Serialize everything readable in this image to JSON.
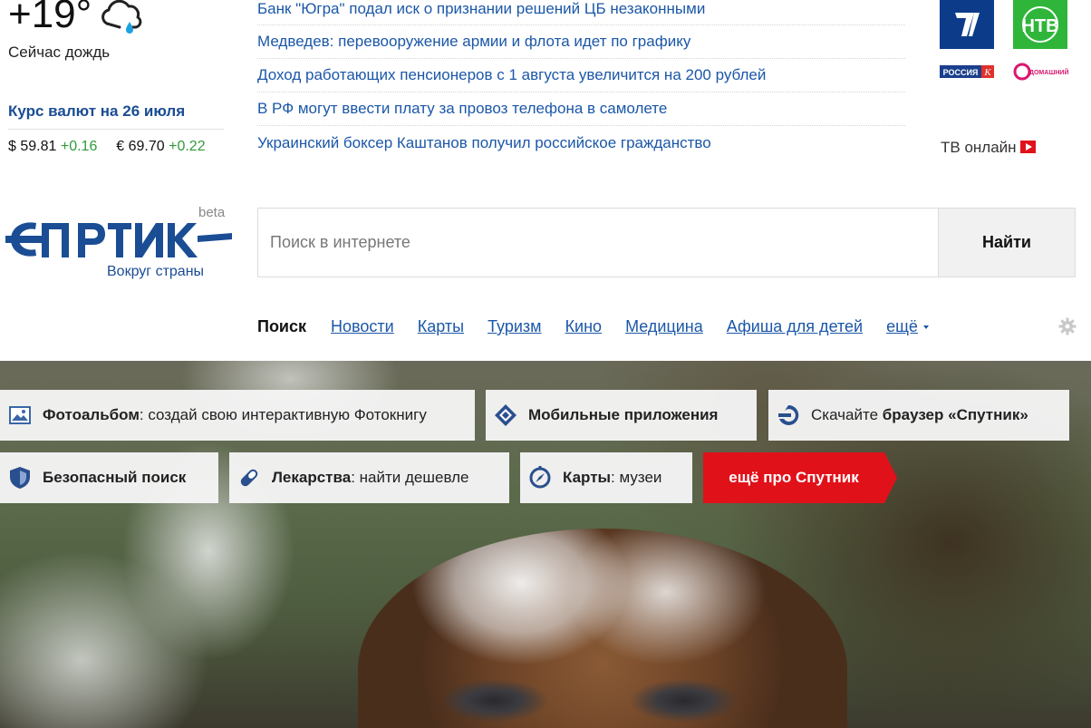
{
  "weather": {
    "temperature": "+19°",
    "description": "Сейчас дождь",
    "icon": "cloud-rain-icon"
  },
  "rates": {
    "title": "Курс валют на 26 июля",
    "usd_symbol": "$",
    "usd_value": "59.81",
    "usd_change": "+0.16",
    "eur_symbol": "€",
    "eur_value": "69.70",
    "eur_change": "+0.22",
    "change_color": "#2f9a3a"
  },
  "news": [
    "Банк \"Югра\" подал иск о признании решений ЦБ незаконными",
    "Медведев: перевооружение армии и флота идет по графику",
    "Доход работающих пенсионеров с 1 августа увеличится на 200 рублей",
    "В РФ могут ввести плату за провоз телефона в самолете",
    "Украинский боксер Каштанов получил российское гражданство"
  ],
  "tv": {
    "channels": [
      {
        "name": "channel-one-logo",
        "label": "1"
      },
      {
        "name": "ntv-logo",
        "label": "НТВ"
      },
      {
        "name": "rossia-k-logo",
        "label": "РОССИЯ К"
      },
      {
        "name": "domashny-logo",
        "label": "ДОМАШНИЙ"
      }
    ],
    "online_label": "ТВ онлайн"
  },
  "logo": {
    "name": "Спутник",
    "beta": "beta",
    "tagline": "Вокруг страны",
    "color": "#1a4d94"
  },
  "search": {
    "placeholder": "Поиск в интернете",
    "button": "Найти"
  },
  "nav": {
    "active": "Поиск",
    "links": [
      "Новости",
      "Карты",
      "Туризм",
      "Кино",
      "Медицина",
      "Афиша для детей"
    ],
    "more": "ещё"
  },
  "tiles": {
    "photo": {
      "bold": "Фотоальбом",
      "rest": ": создай свою интерактивную Фотокнигу",
      "icon": "photo-icon"
    },
    "mobile": {
      "bold": "Мобильные приложения",
      "icon": "mobile-app-icon"
    },
    "browser": {
      "pre": "Скачайте ",
      "bold": "браузер «Спутник»",
      "icon": "browser-icon"
    },
    "safe": {
      "bold": "Безопасный поиск",
      "icon": "shield-icon"
    },
    "meds": {
      "bold": "Лекарства",
      "rest": ": найти дешевле",
      "icon": "pill-icon"
    },
    "maps": {
      "bold": "Карты",
      "rest": ": музеи",
      "icon": "compass-icon"
    },
    "more": {
      "label": "ещё про Спутник",
      "color": "#e1111a"
    }
  }
}
